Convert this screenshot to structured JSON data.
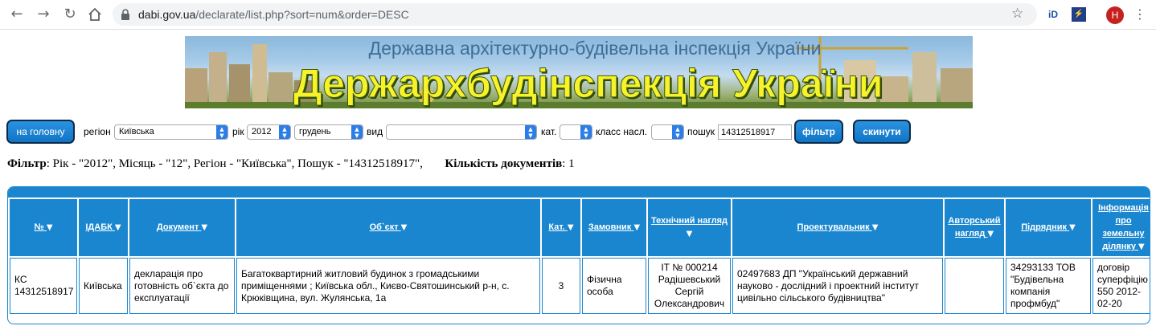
{
  "browser": {
    "url_host": "dabi.gov.ua",
    "url_path": "/declarate/list.php?sort=num&order=DESC",
    "avatar_letter": "H",
    "icons": [
      "back-arrow-icon",
      "forward-arrow-icon",
      "reload-icon",
      "home-icon",
      "lock-icon",
      "star-icon",
      "extension-id-icon",
      "extension-icon",
      "menu-dots-icon"
    ]
  },
  "banner": {
    "subtitle": "Державна архітектурно-будівельна інспекція України",
    "title": "Держархбудінспекція України"
  },
  "filter_bar": {
    "home_button": "на головну",
    "region_label": "регіон",
    "region_value": "Київська",
    "year_label": "рік",
    "year_value": "2012",
    "month_value": "грудень",
    "type_label": "вид",
    "type_value": "",
    "cat_label": "кат.",
    "cat_value": "",
    "class_label": "класс насл.",
    "class_value": "",
    "search_label": "пошук",
    "search_value": "14312518917",
    "filter_button": "фільтр",
    "reset_button": "скинути"
  },
  "summary": {
    "filter_label": "Фільтр",
    "filter_text": ": Рік - \"2012\", Місяць - \"12\", Регіон - \"Київська\", Пошук - \"14312518917\",",
    "count_label": "Кількість документів",
    "count_value": ": 1"
  },
  "table": {
    "headers": [
      "№",
      "ІДАБК",
      "Документ",
      "Об`єкт",
      "Кат.",
      "Замовник",
      "Технічний нагляд",
      "Проектувальник",
      "Авторський нагляд",
      "Підрядник",
      "Інформація про земельну ділянку"
    ],
    "rows": [
      {
        "num": "КС 14312518917",
        "idabk": "Київська",
        "document": "декларація про готовність об`єкта до експлуатації",
        "object": "Багатоквартирний житловий будинок з громадськими приміщеннями ; Київська обл., Києво-Святошинський р-н, с. Крюківщина, вул. Жулянська, 1а",
        "cat": "3",
        "customer": "Фізична особа",
        "tech_supervision": "ІТ № 000214 Радішевський Сергій Олександрович",
        "designer": "02497683 ДП \"Український державний науково - дослідний і проектний інститут цивільно сільського будівництва\"",
        "author_supervision": "",
        "contractor": "34293133 ТОВ \"Будівельна компанія профмбуд\"",
        "land_info": "договір суперфіцію 550 2012-02-20"
      }
    ]
  },
  "colors": {
    "accent_blue": "#1a86cf",
    "button_blue": "#1174c6",
    "banner_yellow": "#f7f22a"
  }
}
